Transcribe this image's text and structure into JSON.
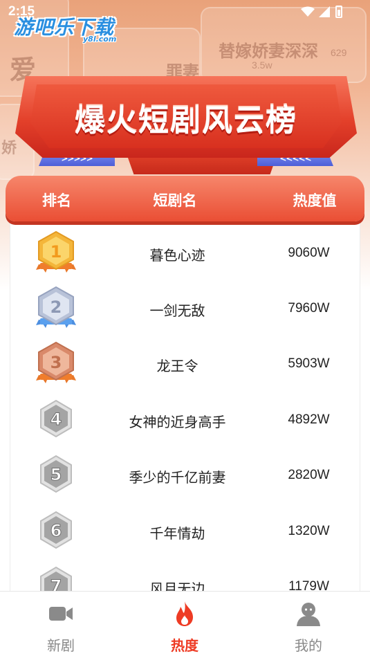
{
  "status_bar": {
    "time": "2:15"
  },
  "watermark": {
    "name": "游吧乐下载",
    "domain": "y8l.com"
  },
  "hero": {
    "background_texts": [
      "替嫁娇妻深深",
      "罪妻",
      "爱",
      "娇"
    ],
    "counts": [
      "629",
      "3.5w"
    ]
  },
  "banner": {
    "title": "爆火短剧风云榜",
    "left_arrows": ">>>>>",
    "right_arrows": "<<<<<"
  },
  "table": {
    "headers": {
      "rank": "排名",
      "name": "短剧名",
      "heat": "热度值"
    },
    "rows": [
      {
        "rank": "1",
        "name": "暮色心迹",
        "heat": "9060W",
        "badge_color": "#f2a72e"
      },
      {
        "rank": "2",
        "name": "一剑无敌",
        "heat": "7960W",
        "badge_color": "#a9b4cc"
      },
      {
        "rank": "3",
        "name": "龙王令",
        "heat": "5903W",
        "badge_color": "#d98a6a"
      },
      {
        "rank": "4",
        "name": "女神的近身高手",
        "heat": "4892W",
        "badge_color": "#9a9a9a"
      },
      {
        "rank": "5",
        "name": "季少的千亿前妻",
        "heat": "2820W",
        "badge_color": "#9a9a9a"
      },
      {
        "rank": "6",
        "name": "千年情劫",
        "heat": "1320W",
        "badge_color": "#9a9a9a"
      },
      {
        "rank": "7",
        "name": "风月无边",
        "heat": "1179W",
        "badge_color": "#9a9a9a"
      }
    ]
  },
  "bottom_nav": {
    "items": [
      {
        "label": "新剧",
        "icon": "video-camera-icon",
        "active": false
      },
      {
        "label": "热度",
        "icon": "flame-icon",
        "active": true
      },
      {
        "label": "我的",
        "icon": "user-icon",
        "active": false
      }
    ]
  },
  "colors": {
    "accent": "#ee3b24",
    "header_gradient_top": "#f6866b",
    "header_gradient_bottom": "#ea4e34",
    "inactive_nav": "#888888"
  }
}
